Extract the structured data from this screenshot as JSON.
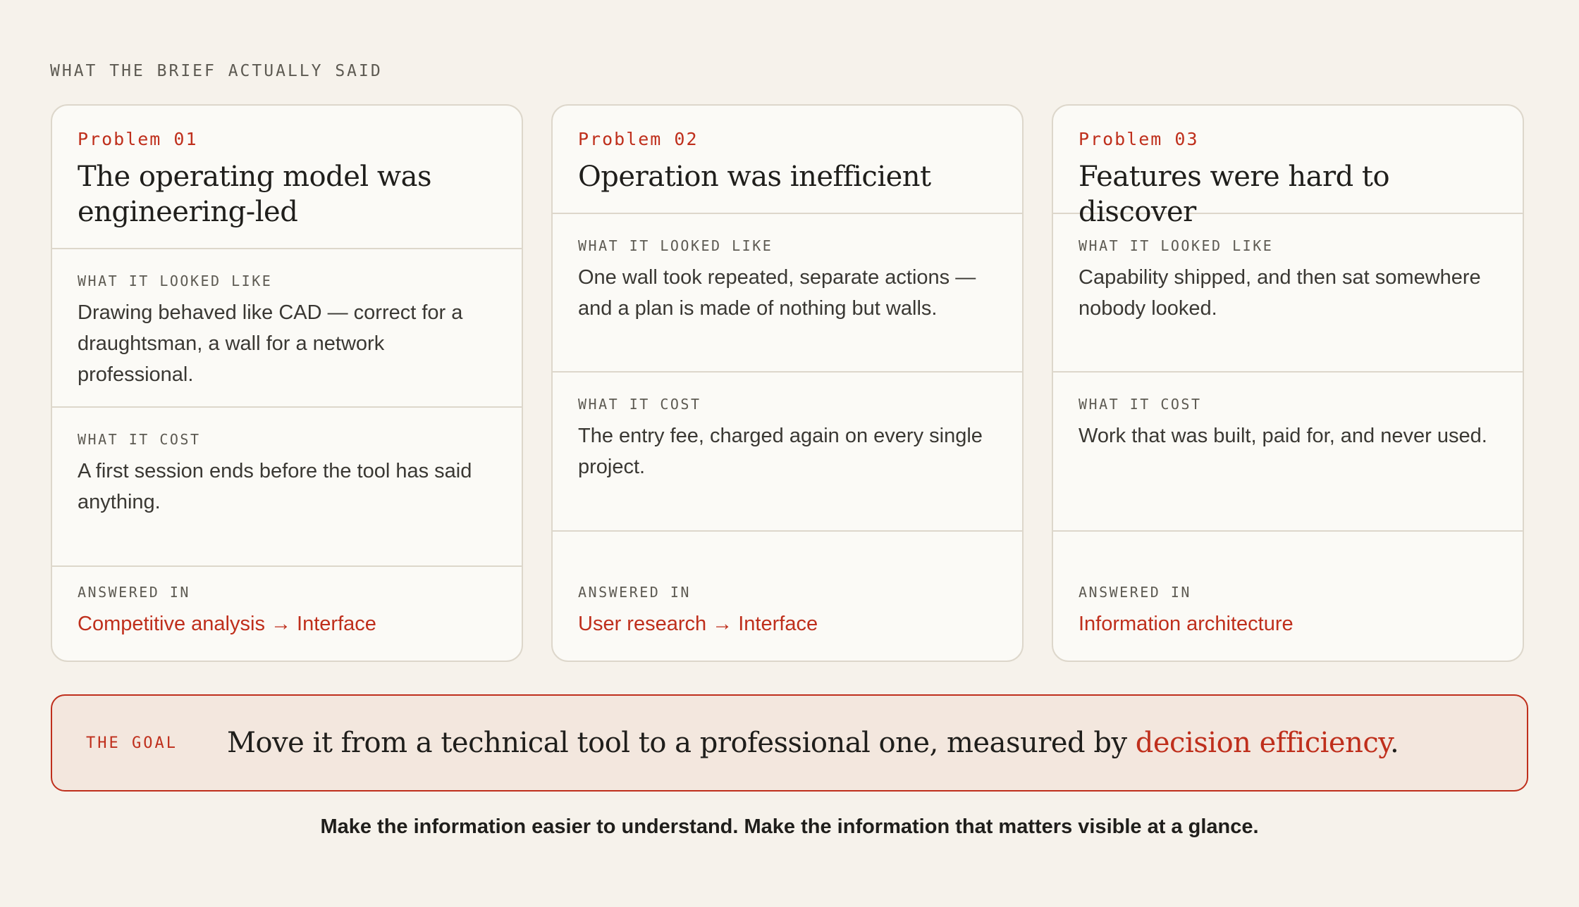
{
  "eyebrow": "WHAT THE BRIEF ACTUALLY SAID",
  "labels": {
    "looked_like": "WHAT IT LOOKED LIKE",
    "cost": "WHAT IT COST",
    "answered_in": "ANSWERED IN"
  },
  "cards": [
    {
      "number": "Problem 01",
      "title": "The operating model was engineering-led",
      "looked_like": "Drawing behaved like CAD — correct for a draughtsman, a wall for a network professional.",
      "cost": "A first session ends before the tool has said anything.",
      "answered_in": "Competitive analysis → Interface"
    },
    {
      "number": "Problem 02",
      "title": "Operation was inefficient",
      "looked_like": "One wall took repeated, separate actions — and a plan is made of nothing but walls.",
      "cost": "The entry fee, charged again on every single project.",
      "answered_in": "User research → Interface"
    },
    {
      "number": "Problem 03",
      "title": "Features were hard to discover",
      "looked_like": "Capability shipped, and then sat somewhere nobody looked.",
      "cost": "Work that was built, paid for, and never used.",
      "answered_in": "Information architecture"
    }
  ],
  "goal": {
    "label": "THE GOAL",
    "text_before": "Move it from a technical tool to a professional one, measured by ",
    "accent": "decision efficiency",
    "text_after": "."
  },
  "footnote": "Make the information easier to understand. Make the information that matters visible at a glance.",
  "colors": {
    "background": "#f6f2eb",
    "card": "#fbfaf6",
    "accent": "#bf2f1c",
    "goal_bg": "#f3e7de"
  }
}
